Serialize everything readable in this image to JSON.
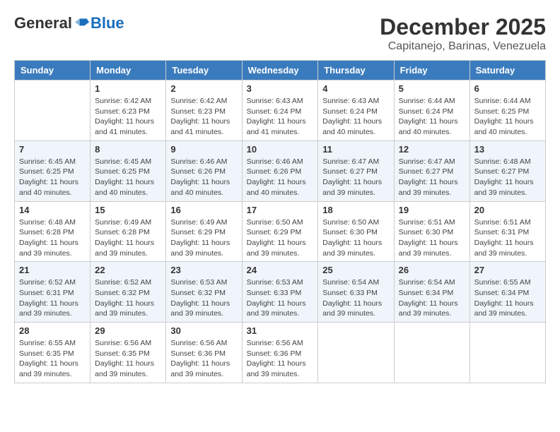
{
  "logo": {
    "general": "General",
    "blue": "Blue"
  },
  "title": "December 2025",
  "location": "Capitanejo, Barinas, Venezuela",
  "days_header": [
    "Sunday",
    "Monday",
    "Tuesday",
    "Wednesday",
    "Thursday",
    "Friday",
    "Saturday"
  ],
  "weeks": [
    [
      {
        "day": "",
        "info": ""
      },
      {
        "day": "1",
        "info": "Sunrise: 6:42 AM\nSunset: 6:23 PM\nDaylight: 11 hours and 41 minutes."
      },
      {
        "day": "2",
        "info": "Sunrise: 6:42 AM\nSunset: 6:23 PM\nDaylight: 11 hours and 41 minutes."
      },
      {
        "day": "3",
        "info": "Sunrise: 6:43 AM\nSunset: 6:24 PM\nDaylight: 11 hours and 41 minutes."
      },
      {
        "day": "4",
        "info": "Sunrise: 6:43 AM\nSunset: 6:24 PM\nDaylight: 11 hours and 40 minutes."
      },
      {
        "day": "5",
        "info": "Sunrise: 6:44 AM\nSunset: 6:24 PM\nDaylight: 11 hours and 40 minutes."
      },
      {
        "day": "6",
        "info": "Sunrise: 6:44 AM\nSunset: 6:25 PM\nDaylight: 11 hours and 40 minutes."
      }
    ],
    [
      {
        "day": "7",
        "info": "Sunrise: 6:45 AM\nSunset: 6:25 PM\nDaylight: 11 hours and 40 minutes."
      },
      {
        "day": "8",
        "info": "Sunrise: 6:45 AM\nSunset: 6:25 PM\nDaylight: 11 hours and 40 minutes."
      },
      {
        "day": "9",
        "info": "Sunrise: 6:46 AM\nSunset: 6:26 PM\nDaylight: 11 hours and 40 minutes."
      },
      {
        "day": "10",
        "info": "Sunrise: 6:46 AM\nSunset: 6:26 PM\nDaylight: 11 hours and 40 minutes."
      },
      {
        "day": "11",
        "info": "Sunrise: 6:47 AM\nSunset: 6:27 PM\nDaylight: 11 hours and 39 minutes."
      },
      {
        "day": "12",
        "info": "Sunrise: 6:47 AM\nSunset: 6:27 PM\nDaylight: 11 hours and 39 minutes."
      },
      {
        "day": "13",
        "info": "Sunrise: 6:48 AM\nSunset: 6:27 PM\nDaylight: 11 hours and 39 minutes."
      }
    ],
    [
      {
        "day": "14",
        "info": "Sunrise: 6:48 AM\nSunset: 6:28 PM\nDaylight: 11 hours and 39 minutes."
      },
      {
        "day": "15",
        "info": "Sunrise: 6:49 AM\nSunset: 6:28 PM\nDaylight: 11 hours and 39 minutes."
      },
      {
        "day": "16",
        "info": "Sunrise: 6:49 AM\nSunset: 6:29 PM\nDaylight: 11 hours and 39 minutes."
      },
      {
        "day": "17",
        "info": "Sunrise: 6:50 AM\nSunset: 6:29 PM\nDaylight: 11 hours and 39 minutes."
      },
      {
        "day": "18",
        "info": "Sunrise: 6:50 AM\nSunset: 6:30 PM\nDaylight: 11 hours and 39 minutes."
      },
      {
        "day": "19",
        "info": "Sunrise: 6:51 AM\nSunset: 6:30 PM\nDaylight: 11 hours and 39 minutes."
      },
      {
        "day": "20",
        "info": "Sunrise: 6:51 AM\nSunset: 6:31 PM\nDaylight: 11 hours and 39 minutes."
      }
    ],
    [
      {
        "day": "21",
        "info": "Sunrise: 6:52 AM\nSunset: 6:31 PM\nDaylight: 11 hours and 39 minutes."
      },
      {
        "day": "22",
        "info": "Sunrise: 6:52 AM\nSunset: 6:32 PM\nDaylight: 11 hours and 39 minutes."
      },
      {
        "day": "23",
        "info": "Sunrise: 6:53 AM\nSunset: 6:32 PM\nDaylight: 11 hours and 39 minutes."
      },
      {
        "day": "24",
        "info": "Sunrise: 6:53 AM\nSunset: 6:33 PM\nDaylight: 11 hours and 39 minutes."
      },
      {
        "day": "25",
        "info": "Sunrise: 6:54 AM\nSunset: 6:33 PM\nDaylight: 11 hours and 39 minutes."
      },
      {
        "day": "26",
        "info": "Sunrise: 6:54 AM\nSunset: 6:34 PM\nDaylight: 11 hours and 39 minutes."
      },
      {
        "day": "27",
        "info": "Sunrise: 6:55 AM\nSunset: 6:34 PM\nDaylight: 11 hours and 39 minutes."
      }
    ],
    [
      {
        "day": "28",
        "info": "Sunrise: 6:55 AM\nSunset: 6:35 PM\nDaylight: 11 hours and 39 minutes."
      },
      {
        "day": "29",
        "info": "Sunrise: 6:56 AM\nSunset: 6:35 PM\nDaylight: 11 hours and 39 minutes."
      },
      {
        "day": "30",
        "info": "Sunrise: 6:56 AM\nSunset: 6:36 PM\nDaylight: 11 hours and 39 minutes."
      },
      {
        "day": "31",
        "info": "Sunrise: 6:56 AM\nSunset: 6:36 PM\nDaylight: 11 hours and 39 minutes."
      },
      {
        "day": "",
        "info": ""
      },
      {
        "day": "",
        "info": ""
      },
      {
        "day": "",
        "info": ""
      }
    ]
  ]
}
